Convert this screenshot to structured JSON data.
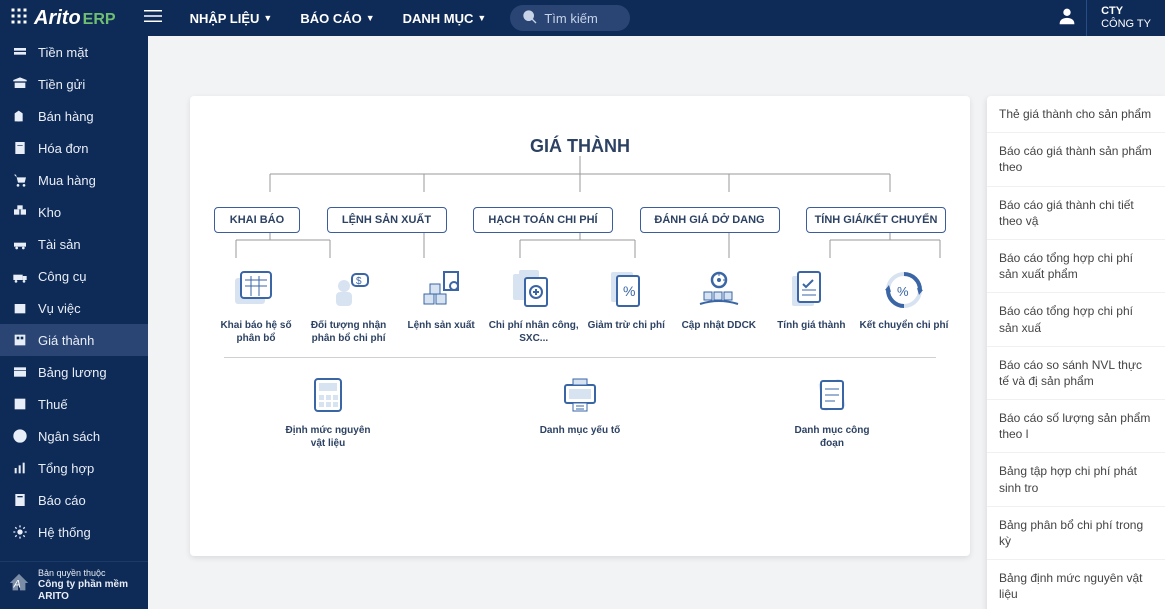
{
  "header": {
    "logo": "Arito",
    "logo_erp": "ERP",
    "nav": [
      {
        "label": "NHẬP LIỆU"
      },
      {
        "label": "BÁO CÁO"
      },
      {
        "label": "DANH MỤC"
      }
    ],
    "search_placeholder": "Tìm kiếm",
    "org_l1": "CTY",
    "org_l2": "CÔNG TY"
  },
  "sidebar": {
    "items": [
      {
        "label": "Tiền mặt"
      },
      {
        "label": "Tiền gửi"
      },
      {
        "label": "Bán hàng"
      },
      {
        "label": "Hóa đơn"
      },
      {
        "label": "Mua hàng"
      },
      {
        "label": "Kho"
      },
      {
        "label": "Tài sản"
      },
      {
        "label": "Công cụ"
      },
      {
        "label": "Vụ việc"
      },
      {
        "label": "Giá thành"
      },
      {
        "label": "Bảng lương"
      },
      {
        "label": "Thuế"
      },
      {
        "label": "Ngân sách"
      },
      {
        "label": "Tổng hợp"
      },
      {
        "label": "Báo cáo"
      },
      {
        "label": "Hệ thống"
      }
    ],
    "active_index": 9,
    "footer_l1": "Bản quyền thuộc",
    "footer_l2": "Công ty phần mềm ARITO"
  },
  "diagram": {
    "title": "GIÁ THÀNH",
    "level1": [
      {
        "label": "KHAI BÁO"
      },
      {
        "label": "LỆNH SẢN XUẤT"
      },
      {
        "label": "HẠCH TOÁN CHI PHÍ"
      },
      {
        "label": "ĐÁNH GIÁ DỞ DANG"
      },
      {
        "label": "TÍNH GIÁ/KẾT CHUYỂN"
      }
    ],
    "leaves": [
      {
        "label": "Khai báo hệ số phân bổ"
      },
      {
        "label": "Đối tượng nhận phân bổ chi phí"
      },
      {
        "label": "Lệnh sản xuất"
      },
      {
        "label": "Chi phí nhân công, SXC..."
      },
      {
        "label": "Giảm trừ chi phí"
      },
      {
        "label": "Cập nhật DDCK"
      },
      {
        "label": "Tính giá thành"
      },
      {
        "label": "Kết chuyển chi phí"
      }
    ],
    "bottom_leaves": [
      {
        "label": "Định mức nguyên vật liệu"
      },
      {
        "label": "Danh mục yếu tố"
      },
      {
        "label": "Danh mục công đoạn"
      }
    ]
  },
  "right_panel": {
    "items": [
      {
        "label": "Thẻ giá thành cho sản phẩm"
      },
      {
        "label": "Báo cáo giá thành sản phẩm theo"
      },
      {
        "label": "Báo cáo giá thành chi tiết theo vậ"
      },
      {
        "label": "Báo cáo tổng hợp chi phí sản xuất phẩm"
      },
      {
        "label": "Báo cáo tổng hợp chi phí sản xuấ"
      },
      {
        "label": "Báo cáo so sánh NVL thực tế và đị sản phẩm"
      },
      {
        "label": "Báo cáo số lượng sản phẩm theo l"
      },
      {
        "label": "Bảng tập hợp chi phí phát sinh tro"
      },
      {
        "label": "Bảng phân bổ chi phí trong kỳ"
      },
      {
        "label": "Bảng định mức nguyên vật liệu"
      }
    ]
  }
}
